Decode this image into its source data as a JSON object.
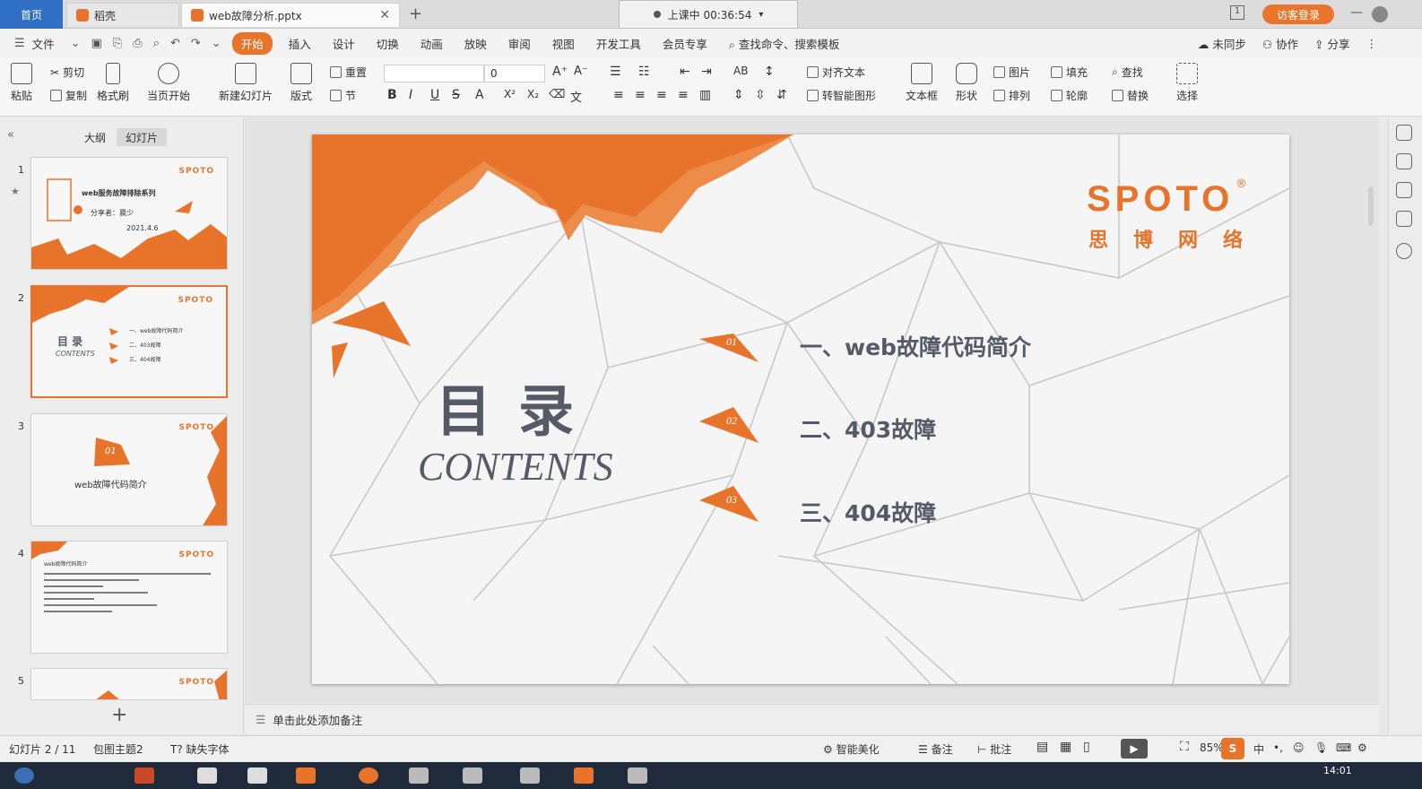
{
  "tabs": {
    "home": "首页",
    "shell": "稻壳",
    "doc": "web故障分析.pptx",
    "add": "+"
  },
  "lesson": {
    "status": "上课中 00:36:54"
  },
  "visitor_login": "访客登录",
  "menu": {
    "file": "文件",
    "items": [
      "开始",
      "插入",
      "设计",
      "切换",
      "动画",
      "放映",
      "审阅",
      "视图",
      "开发工具",
      "会员专享"
    ],
    "active": "开始",
    "search": "查找命令、搜索模板",
    "unsynced": "未同步",
    "collab": "协作",
    "share": "分享"
  },
  "ribbon": {
    "paste": "粘贴",
    "cut": "剪切",
    "copy": "复制",
    "format_painter": "格式刷",
    "play_from_current": "当页开始",
    "new_slide": "新建幻灯片",
    "layout": "版式",
    "reset": "重置",
    "section": "节",
    "font_name": "",
    "font_size": "0",
    "align_text": "对齐文本",
    "smart_art": "转智能图形",
    "textbox": "文本框",
    "shape": "形状",
    "picture": "图片",
    "fill": "填充",
    "arrange": "排列",
    "outline": "轮廓",
    "find": "查找",
    "replace": "替换",
    "select": "选择"
  },
  "left_panel": {
    "outline_tab": "大纲",
    "slides_tab": "幻灯片",
    "add_slide": "+",
    "thumbs": [
      {
        "num": "1",
        "logo": "SPOTO",
        "lines": [
          "web服务故障排除系列",
          "分享者：晨少",
          "2021.4.6"
        ]
      },
      {
        "num": "2",
        "logo": "SPOTO",
        "lines": [
          "目 录",
          "CONTENTS",
          "一、web故障代码简介",
          "二、403故障",
          "三、404故障"
        ]
      },
      {
        "num": "3",
        "logo": "SPOTO",
        "lines": [
          "01",
          "web故障代码简介"
        ]
      },
      {
        "num": "4",
        "logo": "SPOTO",
        "lines": [
          "web故障代码简介"
        ]
      },
      {
        "num": "5",
        "logo": "SPOTO",
        "lines": []
      }
    ]
  },
  "slide": {
    "title": "目录",
    "subtitle": "CONTENTS",
    "brand": "SPOTO",
    "brand_reg": "®",
    "brand_cn": "思博网络",
    "items": [
      {
        "num": "01",
        "text": "一、web故障代码简介"
      },
      {
        "num": "02",
        "text": "二、403故障"
      },
      {
        "num": "03",
        "text": "三、404故障"
      }
    ]
  },
  "notes_placeholder": "单击此处添加备注",
  "status": {
    "slide_index": "幻灯片 2 / 11",
    "theme": "包图主题2",
    "missing_font": "缺失字体",
    "smart_beautify": "智能美化",
    "notes": "备注",
    "comments": "批注",
    "zoom": "85%"
  },
  "taskbar": {
    "clock": "14:01"
  },
  "colors": {
    "accent": "#e8742b",
    "brand_blue": "#2f6fc5",
    "title_gray": "#555a66"
  }
}
